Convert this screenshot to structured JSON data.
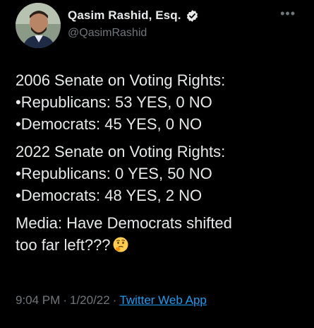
{
  "author": {
    "display_name": "Qasim Rashid, Esq.",
    "handle": "@QasimRashid",
    "verified": true
  },
  "tweet": {
    "paragraphs": [
      [
        "2006 Senate on Voting Rights:",
        "•Republicans: 53 YES, 0 NO",
        "•Democrats: 45 YES, 0 NO"
      ],
      [
        "2022 Senate on Voting Rights:",
        "•Republicans: 0 YES, 50 NO",
        "•Democrats: 48 YES, 2 NO"
      ],
      [
        "Media: Have Democrats shifted",
        "too far left???"
      ]
    ],
    "emoji": "thinking-face-icon"
  },
  "meta": {
    "time": "9:04 PM",
    "separator": "·",
    "date": "1/20/22",
    "source": "Twitter Web App"
  },
  "colors": {
    "background": "#000000",
    "text": "#e7e9ea",
    "muted": "#71767b",
    "link": "#1d9bf0"
  }
}
